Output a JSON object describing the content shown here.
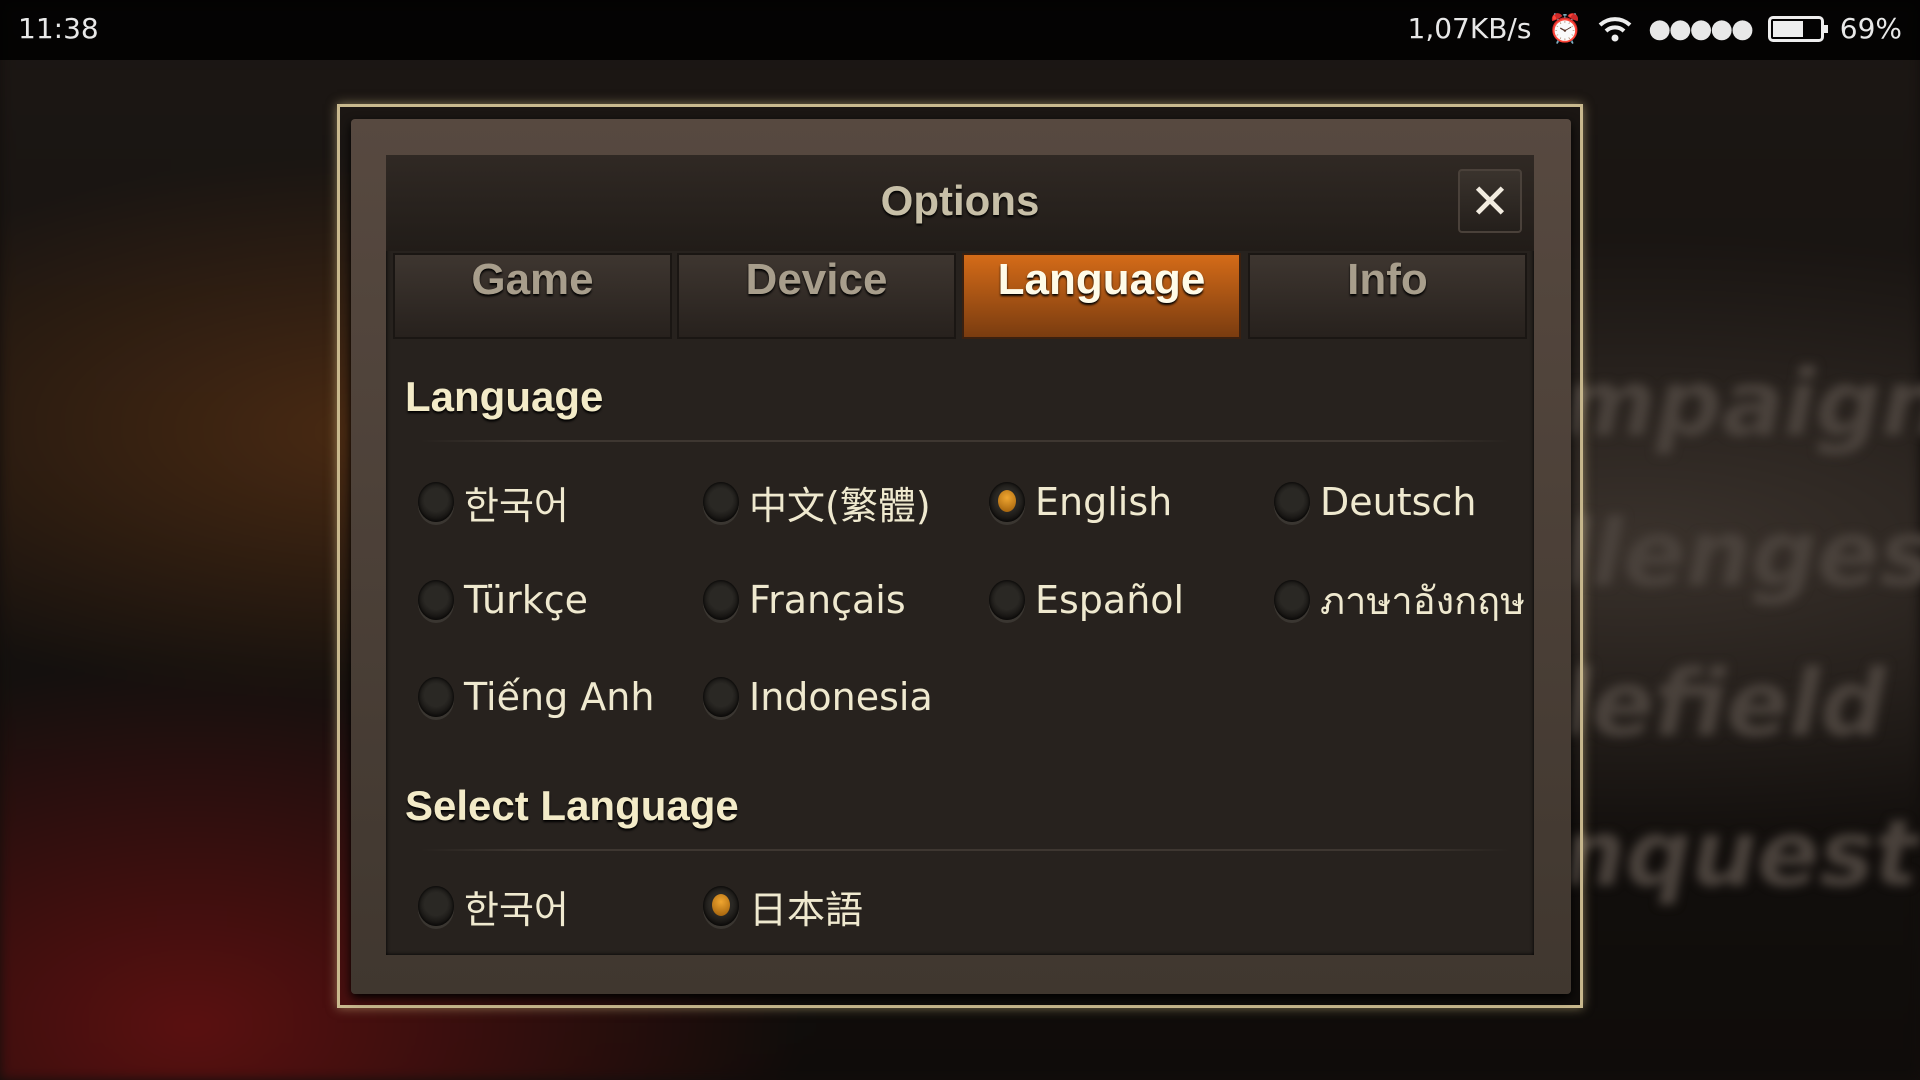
{
  "status_bar": {
    "time": "11:38",
    "network_speed": "1,07KB/s",
    "alarm_icon": "alarm-clock-icon",
    "wifi_icon": "wifi-icon",
    "signal": "●●●●●",
    "battery_level": 69,
    "battery_text": "69%"
  },
  "background_words": [
    "mpaign",
    "llenges",
    "lefield",
    "nquest"
  ],
  "dialog": {
    "title": "Options",
    "close_label": "✕",
    "tabs": [
      {
        "label": "Game",
        "active": false
      },
      {
        "label": "Device",
        "active": false
      },
      {
        "label": "Language",
        "active": true
      },
      {
        "label": "Info",
        "active": false
      }
    ],
    "language_section": {
      "heading": "Language",
      "options": [
        {
          "label": "한국어",
          "selected": false
        },
        {
          "label": "中文(繁體)",
          "selected": false
        },
        {
          "label": "English",
          "selected": true
        },
        {
          "label": "Deutsch",
          "selected": false
        },
        {
          "label": "Türkçe",
          "selected": false
        },
        {
          "label": "Français",
          "selected": false
        },
        {
          "label": "Español",
          "selected": false
        },
        {
          "label": "ภาษาอังกฤษ",
          "selected": false
        },
        {
          "label": "Tiếng Anh",
          "selected": false
        },
        {
          "label": "Indonesia",
          "selected": false
        }
      ]
    },
    "select_language_section": {
      "heading": "Select Language",
      "options": [
        {
          "label": "한국어",
          "selected": false
        },
        {
          "label": "日本語",
          "selected": true
        }
      ]
    }
  },
  "colors": {
    "accent": "#d46b18",
    "text": "#efe9cf",
    "radio_selected": "#e09a28"
  }
}
